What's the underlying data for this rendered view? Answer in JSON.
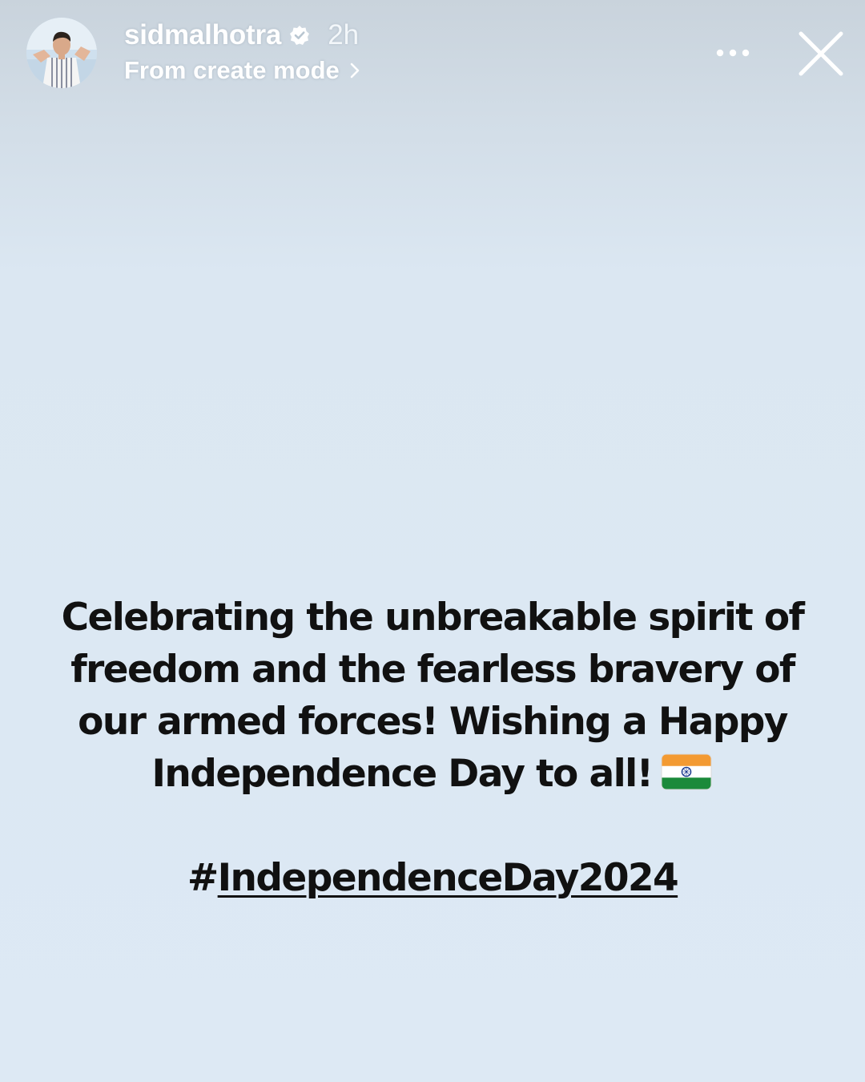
{
  "header": {
    "username": "sidmalhotra",
    "time_ago": "2h",
    "subtitle": "From create mode"
  },
  "post": {
    "caption_lines": [
      "Celebrating the unbreakable spirit of",
      "freedom and the fearless bravery of",
      "our armed forces! Wishing a Happy",
      "Independence Day to all!"
    ],
    "hashtag_symbol": "#",
    "hashtag_text": "IndependenceDay2024"
  },
  "icons": {
    "verified": "verified-badge-icon",
    "chevron": "chevron-right-icon",
    "more": "more-options-icon",
    "close": "close-icon",
    "flag": "india-flag-icon"
  },
  "colors": {
    "background_top": "#c9d3dc",
    "background": "#dde9f4",
    "text": "#111111",
    "header_text": "#ffffff",
    "flag_saffron": "#f39a32",
    "flag_white": "#ffffff",
    "flag_green": "#1b8a3a",
    "chakra_blue": "#1d3c8f"
  }
}
